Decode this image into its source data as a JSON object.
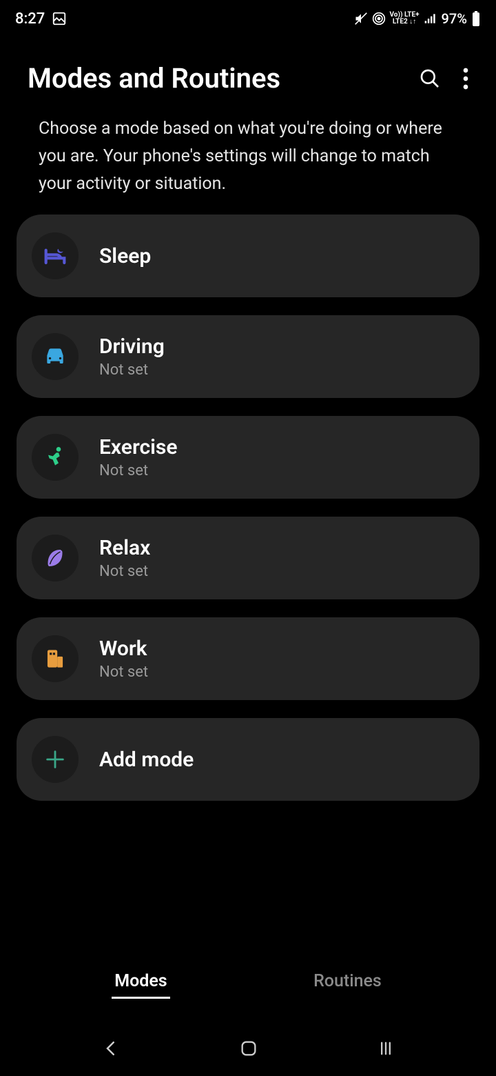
{
  "status": {
    "time": "8:27",
    "battery": "97%",
    "lte_top": "Vo)) LTE+",
    "lte_bottom": "LTE2 ↓↑"
  },
  "header": {
    "title": "Modes and Routines"
  },
  "description": "Choose a mode based on what you're doing or where you are. Your phone's settings will change to match your activity or situation.",
  "modes": [
    {
      "title": "Sleep",
      "subtitle": "",
      "icon": "bed",
      "color": "#5657d5"
    },
    {
      "title": "Driving",
      "subtitle": "Not set",
      "icon": "car",
      "color": "#3aa7e0"
    },
    {
      "title": "Exercise",
      "subtitle": "Not set",
      "icon": "runner",
      "color": "#2dce89"
    },
    {
      "title": "Relax",
      "subtitle": "Not set",
      "icon": "leaf",
      "color": "#9b7ce8"
    },
    {
      "title": "Work",
      "subtitle": "Not set",
      "icon": "building",
      "color": "#e89d3e"
    },
    {
      "title": "Add mode",
      "subtitle": "",
      "icon": "plus",
      "color": "#3aa788"
    }
  ],
  "tabs": {
    "active": "Modes",
    "inactive": "Routines"
  }
}
